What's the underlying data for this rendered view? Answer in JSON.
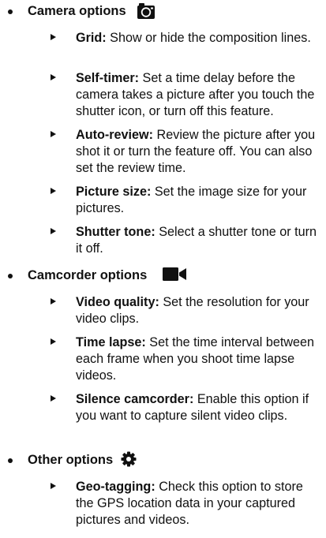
{
  "sections": [
    {
      "title": "Camera options",
      "icon": "camera-icon",
      "items": [
        {
          "term": "Grid:",
          "desc": " Show or hide the composition lines."
        },
        {
          "term": "Self-timer:",
          "desc": " Set a time delay before the camera takes a picture after you touch the shutter icon, or turn off this feature."
        },
        {
          "term": "Auto-review:",
          "desc": " Review the picture after you shot it or turn the feature off. You can also set the review time."
        },
        {
          "term": "Picture size:",
          "desc": " Set the image size for your pictures."
        },
        {
          "term": "Shutter tone:",
          "desc": " Select a shutter tone or turn it off."
        }
      ]
    },
    {
      "title": "Camcorder options",
      "icon": "video-camera-icon",
      "items": [
        {
          "term": "Video quality:",
          "desc": " Set the resolution for your video clips."
        },
        {
          "term": "Time lapse:",
          "desc": " Set the time interval between each frame when you shoot time lapse videos."
        },
        {
          "term": "Silence camcorder:",
          "desc": " Enable this option if you want to capture silent video clips."
        }
      ]
    },
    {
      "title": "Other options",
      "icon": "gear-icon",
      "items": [
        {
          "term": "Geo-tagging:",
          "desc": " Check this option to store the GPS location data in your captured pictures and videos."
        }
      ]
    }
  ]
}
